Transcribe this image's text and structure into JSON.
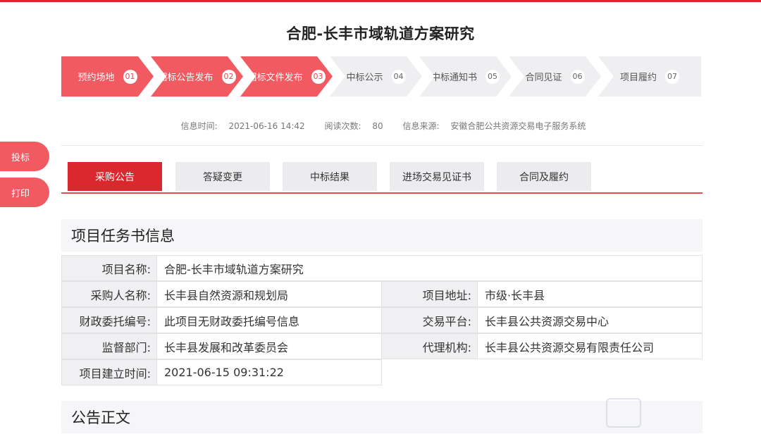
{
  "page": {
    "title": "合肥-长丰市域轨道方案研究"
  },
  "steps": [
    {
      "label": "预约场地",
      "num": "01",
      "state": "done"
    },
    {
      "label": "招标公告发布",
      "num": "02",
      "state": "done"
    },
    {
      "label": "招标文件发布",
      "num": "03",
      "state": "done"
    },
    {
      "label": "中标公示",
      "num": "04",
      "state": "todo"
    },
    {
      "label": "中标通知书",
      "num": "05",
      "state": "todo"
    },
    {
      "label": "合同见证",
      "num": "06",
      "state": "todo"
    },
    {
      "label": "项目履约",
      "num": "07",
      "state": "todo"
    }
  ],
  "meta": {
    "time_label": "信息时间:",
    "time_value": "2021-06-16 14:42",
    "reads_label": "阅读次数:",
    "reads_value": "80",
    "source_label": "信息来源:",
    "source_value": "安徽合肥公共资源交易电子服务系统"
  },
  "side": {
    "bid_label": "投标",
    "print_label": "打印"
  },
  "tabs": [
    {
      "label": "采购公告",
      "active": true
    },
    {
      "label": "答疑变更",
      "active": false
    },
    {
      "label": "中标结果",
      "active": false
    },
    {
      "label": "进场交易见证书",
      "active": false
    },
    {
      "label": "合同及履约",
      "active": false
    }
  ],
  "task_section": {
    "title": "项目任务书信息"
  },
  "info": {
    "project_name_label": "项目名称:",
    "project_name_value": "合肥-长丰市域轨道方案研究",
    "purchaser_label": "采购人名称:",
    "purchaser_value": "长丰县自然资源和规划局",
    "address_label": "项目地址:",
    "address_value": "市级·长丰县",
    "finance_no_label": "财政委托编号:",
    "finance_no_value": "此项目无财政委托编号信息",
    "platform_label": "交易平台:",
    "platform_value": "长丰县公共资源交易中心",
    "supervisor_label": "监督部门:",
    "supervisor_value": "长丰县发展和改革委员会",
    "agency_label": "代理机构:",
    "agency_value": "长丰县公共资源交易有限责任公司",
    "created_label": "项目建立时间:",
    "created_value": "2021-06-15 09:31:22"
  },
  "notice_section": {
    "title": "公告正文"
  },
  "colors": {
    "accent": "#d9282e",
    "step_done": "#f25a62",
    "step_todo": "#efeff1"
  }
}
